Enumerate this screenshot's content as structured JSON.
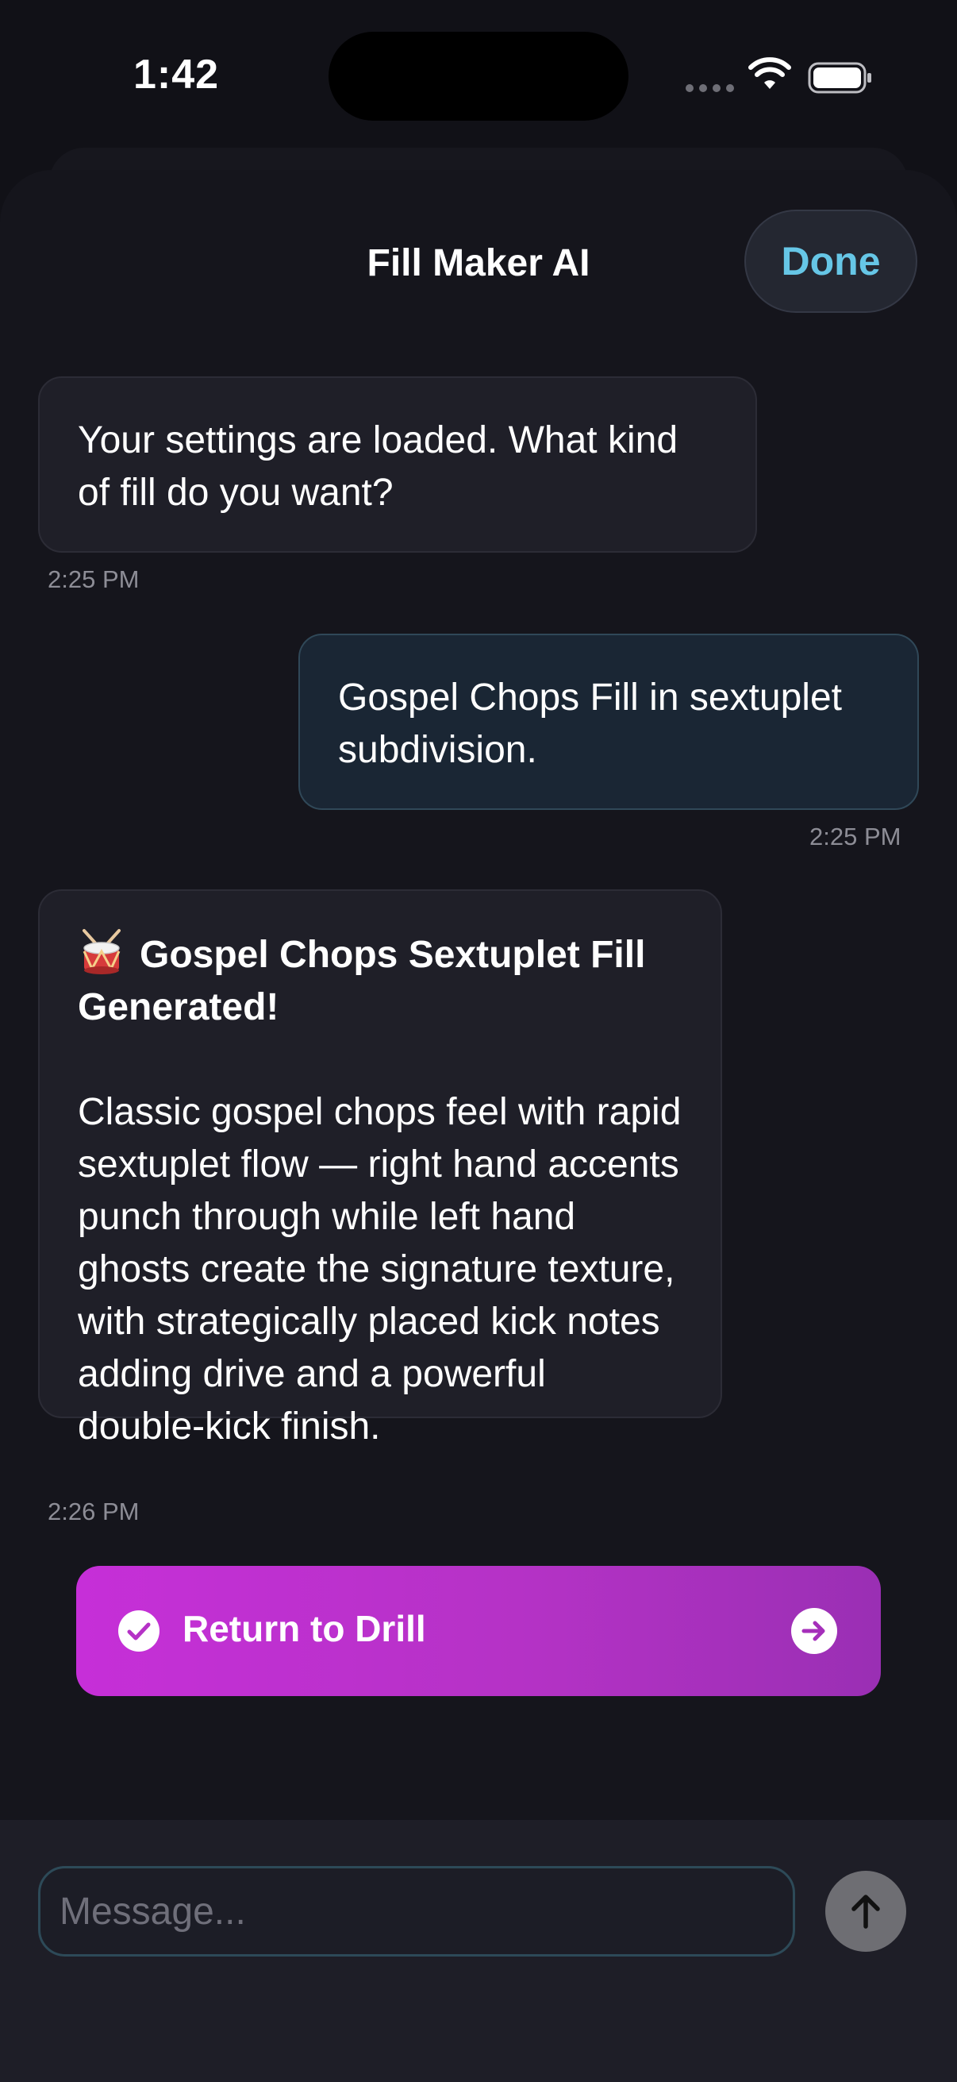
{
  "status_bar": {
    "time": "1:42"
  },
  "header": {
    "title": "Fill Maker AI",
    "done_label": "Done"
  },
  "messages": [
    {
      "sender": "assistant",
      "text": "Your settings are loaded. What kind of fill do you want?",
      "time": "2:25 PM"
    },
    {
      "sender": "user",
      "text": "Gospel Chops Fill in sextuplet subdivision.",
      "time": "2:25 PM"
    },
    {
      "sender": "assistant",
      "title": "Gospel Chops Sextuplet Fill Generated!",
      "icon": "drum-icon",
      "text": "Classic gospel chops feel with rapid sextuplet flow — right hand accents punch through while left hand ghosts create the signature texture, with strategically placed kick notes adding drive and a powerful double-kick finish.",
      "time": "2:26 PM"
    }
  ],
  "action": {
    "label": "Return to Drill",
    "leading_icon": "check-circle-icon",
    "trailing_icon": "arrow-right-circle-icon"
  },
  "composer": {
    "placeholder": "Message...",
    "value": ""
  },
  "colors": {
    "background": "#111117",
    "sheet": "#15151c",
    "accent_done": "#66c6e6",
    "action_gradient_start": "#c62fd8",
    "action_gradient_end": "#9a2fb4",
    "send_button": "#6e6e73"
  }
}
